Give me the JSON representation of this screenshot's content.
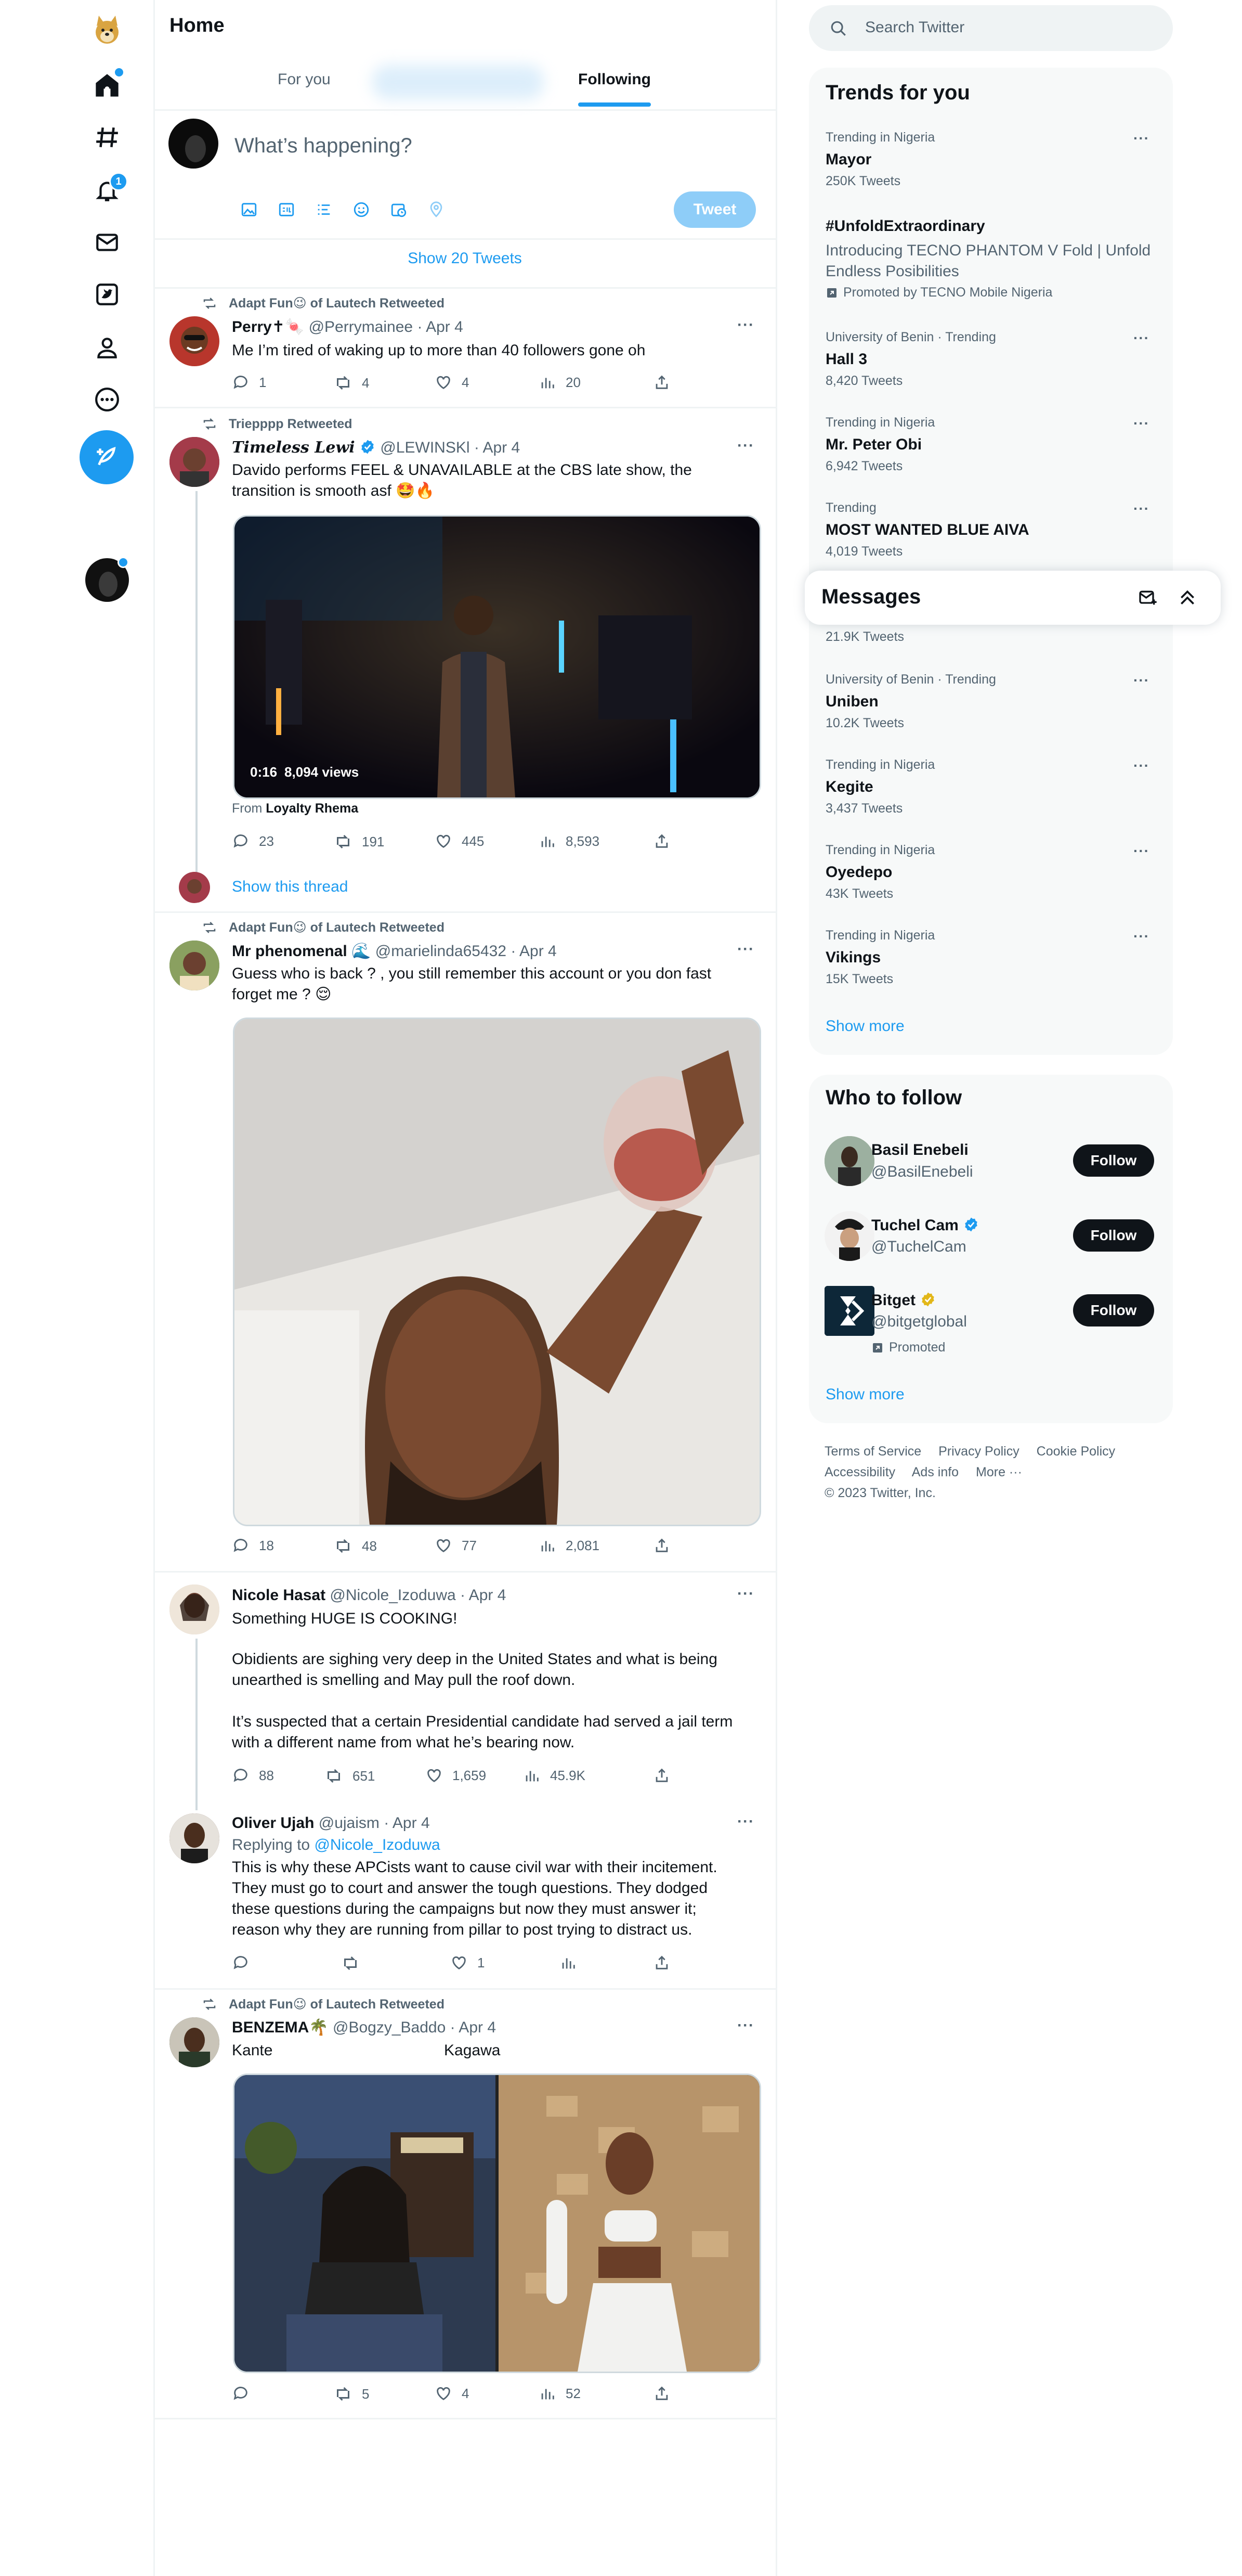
{
  "header": {
    "title": "Home",
    "tabs": [
      "For you",
      "Following"
    ]
  },
  "nav": {
    "notification_count": "1"
  },
  "composer": {
    "placeholder": "What’s happening?",
    "tweet_button": "Tweet"
  },
  "show_tweets": "Show 20 Tweets",
  "tweets": [
    {
      "retweeted_by": "Adapt Fun😉 of Lautech Retweeted",
      "name": "Perry✝🍬",
      "handle": "@Perrymainee",
      "date": "· Apr 4",
      "text": "Me I’m tired of waking up to more than 40 followers gone oh",
      "replies": "1",
      "retweets": "4",
      "likes": "4",
      "views": "20"
    },
    {
      "retweeted_by": "Triepppp Retweeted",
      "name": "𝑻𝒊𝒎𝒆𝒍𝒆𝒔𝒔 𝑳𝒆𝒘𝒊",
      "handle": "@LEWINSKl",
      "date": "· Apr 4",
      "text": "Davido performs FEEL & UNAVAILABLE at the CBS late show, the transition is smooth asf 🤩🔥",
      "video_time": "0:16",
      "video_views": "8,094 views",
      "from_label": "From",
      "from_name": "Loyalty Rhema",
      "replies": "23",
      "retweets": "191",
      "likes": "445",
      "views": "8,593",
      "show_thread": "Show this thread"
    },
    {
      "retweeted_by": "Adapt Fun😉 of Lautech Retweeted",
      "name": "Mr phenomenal 🌊",
      "handle": "@marielinda65432",
      "date": "· Apr 4",
      "text": "Guess who is back ? , you still remember this account or you don fast forget me ? 😌",
      "replies": "18",
      "retweets": "48",
      "likes": "77",
      "views": "2,081"
    },
    {
      "name": "Nicole Hasat",
      "handle": "@Nicole_Izoduwa",
      "date": "· Apr 4",
      "text1": "Something HUGE IS COOKING!",
      "text2": "Obidients are sighing very deep in the United States and what is being unearthed is smelling and May pull the roof down.",
      "text3": "It’s suspected that a certain Presidential candidate had served a jail term with a different name from what he’s bearing now.",
      "replies": "88",
      "retweets": "651",
      "likes": "1,659",
      "views": "45.9K"
    },
    {
      "name": "Oliver Ujah",
      "handle": "@ujaism",
      "date": "· Apr 4",
      "replying_label": "Replying to",
      "replying_to": "@Nicole_Izoduwa",
      "text": "This is why these APCists want to cause civil war with their incitement. They must go to court and answer the tough questions. They dodged these questions during the campaigns but now they must answer it; reason why they are running from pillar to post trying to distract us.",
      "likes": "1"
    },
    {
      "retweeted_by": "Adapt Fun😉 of Lautech Retweeted",
      "name": "BENZEMA🌴",
      "handle": "@Bogzy_Baddo",
      "date": "· Apr 4",
      "text_left": "Kante",
      "text_right": "Kagawa",
      "retweets": "5",
      "likes": "4",
      "views": "52"
    }
  ],
  "search": {
    "placeholder": "Search Twitter"
  },
  "trends": {
    "title": "Trends for you",
    "items": [
      {
        "meta": "Trending in Nigeria",
        "name": "Mayor",
        "count": "250K Tweets"
      },
      {
        "name": "#UnfoldExtraordinary",
        "desc": "Introducing TECNO PHANTOM V Fold | Unfold Endless Posibilities",
        "promoted": "Promoted by TECNO Mobile Nigeria"
      },
      {
        "meta": "University of Benin · Trending",
        "name": "Hall 3",
        "count": "8,420 Tweets"
      },
      {
        "meta": "Trending in Nigeria",
        "name": "Mr. Peter Obi",
        "count": "6,942 Tweets"
      },
      {
        "meta": "Trending",
        "name": "MOST WANTED BLUE AIVA",
        "count": "4,019 Tweets"
      },
      {
        "count": "21.9K Tweets"
      },
      {
        "meta": "University of Benin · Trending",
        "name": "Uniben",
        "count": "10.2K Tweets"
      },
      {
        "meta": "Trending in Nigeria",
        "name": "Kegite",
        "count": "3,437 Tweets"
      },
      {
        "meta": "Trending in Nigeria",
        "name": "Oyedepo",
        "count": "43K Tweets"
      },
      {
        "meta": "Trending in Nigeria",
        "name": "Vikings",
        "count": "15K Tweets"
      }
    ],
    "show_more": "Show more"
  },
  "messages": {
    "title": "Messages"
  },
  "who_to_follow": {
    "title": "Who to follow",
    "items": [
      {
        "name": "Basil Enebeli",
        "handle": "@BasilEnebeli"
      },
      {
        "name": "Tuchel Cam",
        "handle": "@TuchelCam"
      },
      {
        "name": "Bitget",
        "handle": "@bitgetglobal",
        "promoted": "Promoted"
      }
    ],
    "follow_label": "Follow",
    "show_more": "Show more"
  },
  "footer": {
    "links": [
      "Terms of Service",
      "Privacy Policy",
      "Cookie Policy",
      "Accessibility",
      "Ads info",
      "More ···"
    ],
    "copyright": "© 2023 Twitter, Inc."
  },
  "colors": {
    "accent": "#1d9bf0",
    "text": "#0f1419",
    "muted": "#536471",
    "border": "#eff3f4",
    "card": "#f7f9f9"
  }
}
